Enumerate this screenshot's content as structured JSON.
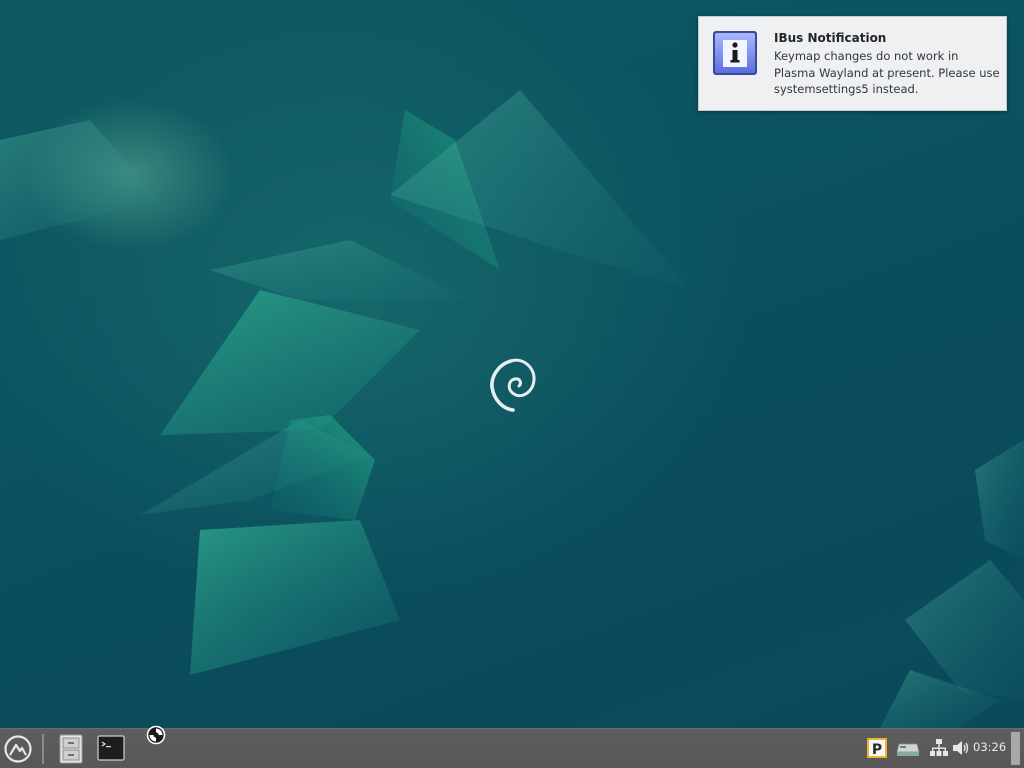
{
  "notification": {
    "title": "IBus Notification",
    "body": "Keymap changes do not work in Plasma Wayland at present. Please use systemsettings5 instead.",
    "icon": "info-icon"
  },
  "taskbar": {
    "launcher_icon": "application-launcher-icon",
    "quick_launch": [
      {
        "icon": "file-manager-icon"
      },
      {
        "icon": "terminal-icon"
      }
    ],
    "tray": [
      {
        "icon": "clipboard-p-icon"
      },
      {
        "icon": "removable-drive-icon"
      },
      {
        "icon": "network-icon"
      },
      {
        "icon": "volume-icon"
      }
    ],
    "clock": "03:26"
  },
  "desktop": {
    "logo": "debian-swirl-logo"
  },
  "colors": {
    "wallpaper_base": "#0b4f5e",
    "wallpaper_accent": "#2aa58a",
    "taskbar": "#5a5a5a",
    "notification_bg": "#eff0f1"
  }
}
